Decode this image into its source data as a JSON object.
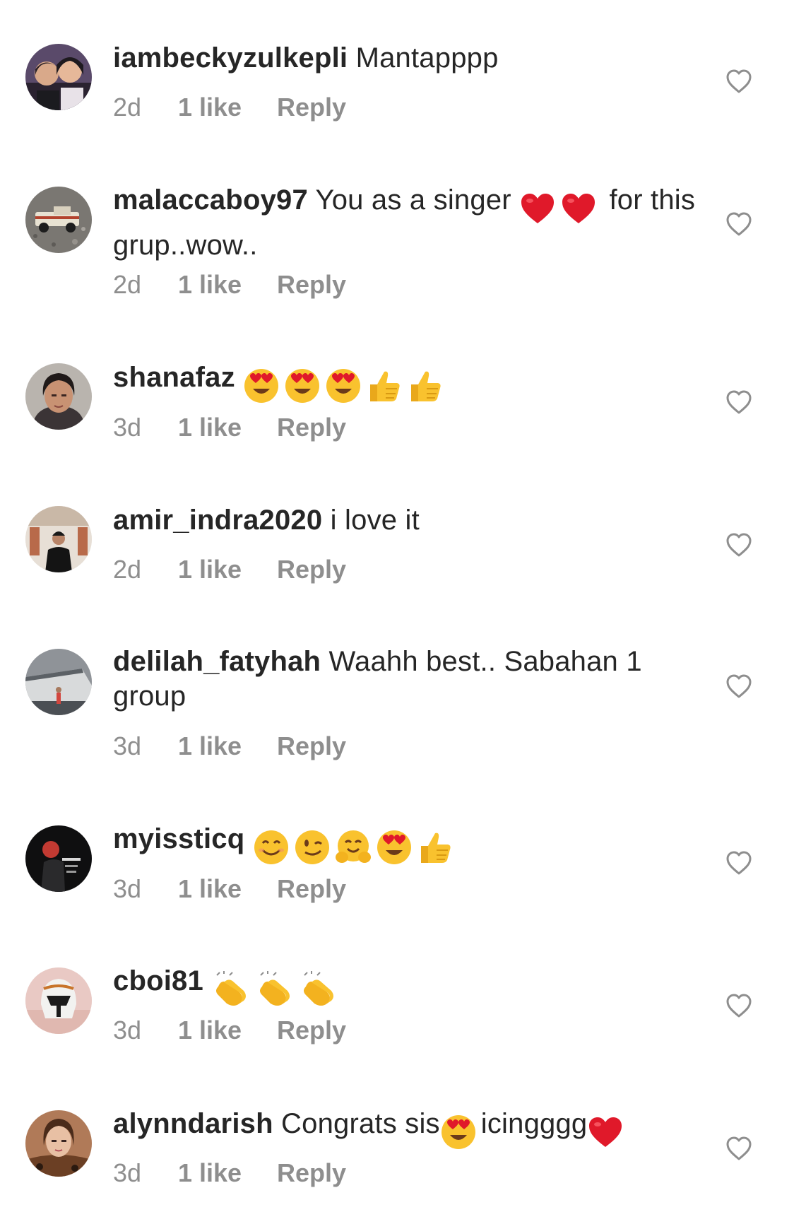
{
  "comments": [
    {
      "username": "iambeckyzulkepli",
      "text": "Mantapppp",
      "emojis": [],
      "text_after": "",
      "time": "2d",
      "likes": "1 like",
      "reply": "Reply",
      "avatar_icon": "avatar-couple-photo"
    },
    {
      "username": "malaccaboy97",
      "text": "You as a singer",
      "emojis": [
        "red-heart",
        "red-heart"
      ],
      "text_after": "for this grup..wow..",
      "time": "2d",
      "likes": "1 like",
      "reply": "Reply",
      "avatar_icon": "avatar-toy-truck-photo"
    },
    {
      "username": "shanafaz",
      "text": "",
      "emojis": [
        "heart-eyes",
        "heart-eyes",
        "heart-eyes",
        "thumbs-up",
        "thumbs-up"
      ],
      "text_after": "",
      "time": "3d",
      "likes": "1 like",
      "reply": "Reply",
      "avatar_icon": "avatar-woman-photo"
    },
    {
      "username": "amir_indra2020",
      "text": "i love it",
      "emojis": [],
      "text_after": "",
      "time": "2d",
      "likes": "1 like",
      "reply": "Reply",
      "avatar_icon": "avatar-man-standing-photo"
    },
    {
      "username": "delilah_fatyhah",
      "text": "Waahh best.. Sabahan 1 group",
      "emojis": [],
      "text_after": "",
      "time": "3d",
      "likes": "1 like",
      "reply": "Reply",
      "avatar_icon": "avatar-ship-photo"
    },
    {
      "username": "myissticq",
      "text": "",
      "emojis": [
        "smiling-face",
        "winking-face",
        "hugging-face",
        "heart-eyes",
        "thumbs-up"
      ],
      "text_after": "",
      "time": "3d",
      "likes": "1 like",
      "reply": "Reply",
      "avatar_icon": "avatar-dark-graphic"
    },
    {
      "username": "cboi81",
      "text": "",
      "emojis": [
        "clapping-hands",
        "clapping-hands",
        "clapping-hands"
      ],
      "text_after": "",
      "time": "3d",
      "likes": "1 like",
      "reply": "Reply",
      "avatar_icon": "avatar-helmet-figure"
    },
    {
      "username": "alynndarish",
      "text": "Congrats sis",
      "emojis": [
        "heart-eyes"
      ],
      "text_after": "icingggg",
      "emojis_after": [
        "red-heart"
      ],
      "time": "3d",
      "likes": "1 like",
      "reply": "Reply",
      "avatar_icon": "avatar-woman-selfie"
    }
  ],
  "like_button_icon": "heart-outline-icon",
  "colors": {
    "text": "#262626",
    "meta": "#8e8e8e",
    "heart_outline": "#8e8e8e"
  }
}
